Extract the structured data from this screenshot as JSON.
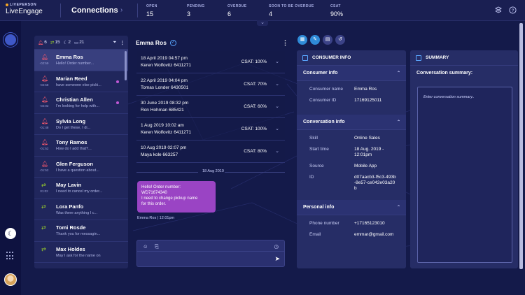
{
  "brand": {
    "small": "LIVEPERSON",
    "name": "LiveEngage"
  },
  "header": {
    "title": "Connections",
    "stats": [
      {
        "label": "OPEN",
        "value": "15"
      },
      {
        "label": "PENDING",
        "value": "3"
      },
      {
        "label": "OVERDUE",
        "value": "6"
      },
      {
        "label": "SOON TO BE OVERDUE",
        "value": "4"
      },
      {
        "label": "CSAT",
        "value": "90%"
      }
    ]
  },
  "list": {
    "counts": {
      "alerts": "6",
      "transfers": "15",
      "away": "2",
      "chats": "21"
    },
    "items": [
      {
        "name": "Emma Ros",
        "snippet": "Hello! Order number...",
        "time": "-02:59",
        "icon": "bell"
      },
      {
        "name": "Marian Reed",
        "snippet": "have someone else picki...",
        "time": "-02:58",
        "icon": "bell"
      },
      {
        "name": "Christian Allen",
        "snippet": "I'm looking for help with...",
        "time": "-02:02",
        "icon": "bell"
      },
      {
        "name": "Sylvia Long",
        "snippet": "Do I get these, I di...",
        "time": "-01:48",
        "icon": "bell"
      },
      {
        "name": "Tony Ramos",
        "snippet": "How do I add that?...",
        "time": "-01:52",
        "icon": "bell"
      },
      {
        "name": "Glen Ferguson",
        "snippet": "I have a question about...",
        "time": "-01:52",
        "icon": "bell"
      },
      {
        "name": "May Lavin",
        "snippet": "I need to cancel my order...",
        "time": "01:02",
        "icon": "arrows"
      },
      {
        "name": "Lora Panfo",
        "snippet": "Was there anything I c...",
        "time": "",
        "icon": "arrows"
      },
      {
        "name": "Tomi Rosde",
        "snippet": "Thank you for messagin...",
        "time": "",
        "icon": "arrows"
      },
      {
        "name": "Max Holdes",
        "snippet": "May I ask for the name on",
        "time": "",
        "icon": "arrows"
      }
    ]
  },
  "chat": {
    "name": "Emma Ros",
    "history": [
      {
        "date": "18 April 2019 04:57 pm",
        "agent": "Keren Wolfovitz  6411271",
        "csat": "CSAT: 100%"
      },
      {
        "date": "22 April 2019 04:04 pm",
        "agent": "Tomas Londer  6430501",
        "csat": "CSAT: 70%"
      },
      {
        "date": "30 June 2019 08:32 pm",
        "agent": "Ron Hohman  685421",
        "csat": "CSAT: 60%"
      },
      {
        "date": "1 Aug 2019 10:02 am",
        "agent": "Keren Wolfovitz  6411271",
        "csat": "CSAT: 100%"
      },
      {
        "date": "10 Aug 2019 02:07 pm",
        "agent": "Maya kole  663257",
        "csat": "CSAT: 80%"
      }
    ],
    "day_separator": "18 Aug 2019",
    "message": {
      "line1": "Hello! Order number:",
      "line2": "WD71674340",
      "line3": "I need to change pickup name",
      "line4": "for this order.",
      "meta": "Emma Ros  |  12:01pm"
    }
  },
  "consumer": {
    "panel_title": "CONSUMER INFO",
    "sections": {
      "consumer_info": "Consumer info",
      "conversation_info": "Conversation info",
      "personal_info": "Personal info"
    },
    "consumer_name_label": "Consumer name",
    "consumer_name": "Emma Ros",
    "consumer_id_label": "Consumer ID",
    "consumer_id": "17169125011",
    "skill_label": "Skill",
    "skill": "Online Sales",
    "start_time_label": "Start time",
    "start_time": "18 Aug. 2019 - 12:01pm",
    "source_label": "Source",
    "source": "Mobile App",
    "id_label": "ID",
    "id": "d07aacb3-f5c3-493b-8e57-ce042e03a20b",
    "phone_label": "Phone number",
    "phone": "+17165123010",
    "email_label": "Email",
    "email": "emmar@gmail.com"
  },
  "summary": {
    "panel_title": "SUMMARY",
    "label": "Conversation summary:",
    "placeholder": "Enter conversation summary.."
  },
  "colors": {
    "accent": "#5aa7ff",
    "bell": "#ff5a6e",
    "transfer": "#9bd12a",
    "bubble": "#9a44c4"
  }
}
